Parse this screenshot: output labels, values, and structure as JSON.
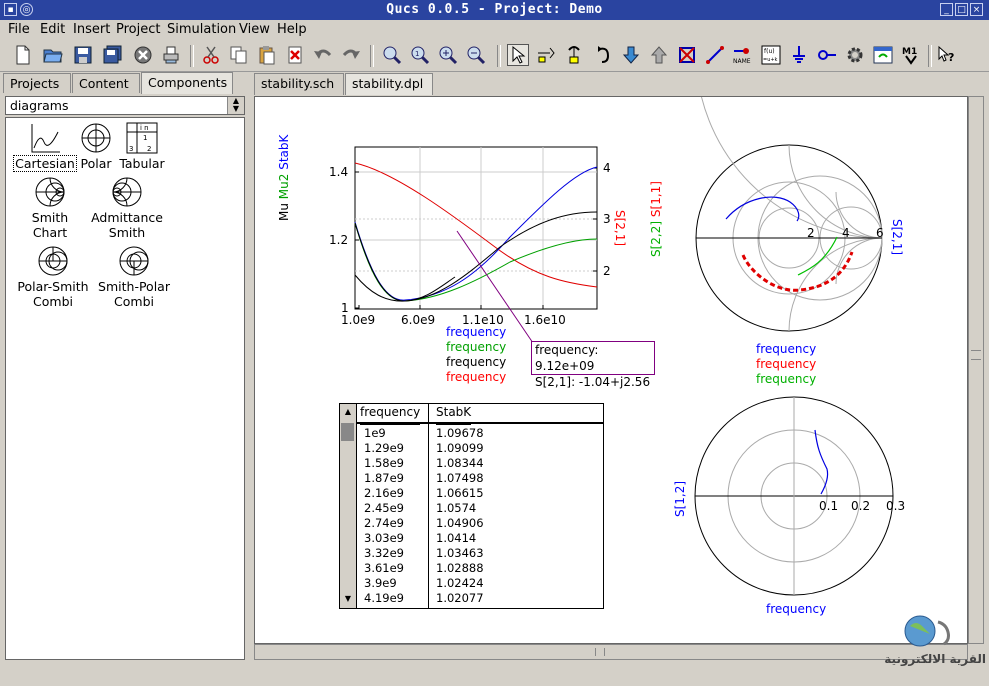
{
  "window": {
    "title": "Qucs 0.0.5 - Project: Demo"
  },
  "menubar": [
    "File",
    "Edit",
    "Insert",
    "Project",
    "Simulation",
    "View",
    "Help"
  ],
  "left_tabs": [
    "Projects",
    "Content",
    "Components"
  ],
  "combo": {
    "selected": "diagrams"
  },
  "components": [
    {
      "label": "Cartesian",
      "icon": "cartesian-icon"
    },
    {
      "label": "Polar",
      "icon": "polar-icon"
    },
    {
      "label": "Tabular",
      "icon": "tabular-icon"
    },
    {
      "label": "Smith Chart",
      "icon": "smith-chart-icon"
    },
    {
      "label": "Admittance Smith",
      "icon": "admittance-smith-icon"
    },
    {
      "label": "Polar-Smith Combi",
      "icon": "polar-smith-icon"
    },
    {
      "label": "Smith-Polar Combi",
      "icon": "smith-polar-icon"
    }
  ],
  "doc_tabs": [
    "stability.sch",
    "stability.dpl"
  ],
  "cartesian": {
    "ylabels_left": [
      {
        "text": "Mu",
        "color": "#000000"
      },
      {
        "text": "Mu2",
        "color": "#00a000"
      },
      {
        "text": "StabK",
        "color": "#0000ff"
      }
    ],
    "ylabel_right": {
      "text": "S[2,1]",
      "color": "#ff0000"
    },
    "yticks_left": [
      "1.4",
      "1.2",
      "1"
    ],
    "yticks_right": [
      "4",
      "3",
      "2"
    ],
    "xticks": [
      "1.0e9",
      "6.0e9",
      "1.1e10",
      "1.6e10"
    ],
    "legend": [
      {
        "text": "frequency",
        "color": "#0000ff"
      },
      {
        "text": "frequency",
        "color": "#00a000"
      },
      {
        "text": "frequency",
        "color": "#000000"
      },
      {
        "text": "frequency",
        "color": "#ff0000"
      }
    ]
  },
  "marker": {
    "line1": "frequency: 9.12e+09",
    "line2": "S[2,1]: -1.04+j2.56"
  },
  "smith": {
    "labels_left": [
      {
        "text": "S[2,2]",
        "color": "#00b000"
      },
      {
        "text": "S[1,1]",
        "color": "#ff0000"
      }
    ],
    "label_right": {
      "text": "S[2,1]",
      "color": "#0000ff"
    },
    "ticks": [
      "2",
      "4",
      "6"
    ],
    "legend": [
      {
        "text": "frequency",
        "color": "#0000ff"
      },
      {
        "text": "frequency",
        "color": "#ff0000"
      },
      {
        "text": "frequency",
        "color": "#00b000"
      }
    ]
  },
  "polar": {
    "label_left": {
      "text": "S[1,2]",
      "color": "#0000ff"
    },
    "ticks": [
      "0.1",
      "0.2",
      "0.3"
    ],
    "legend": {
      "text": "frequency",
      "color": "#0000ff"
    }
  },
  "table": {
    "headers": [
      "frequency",
      "StabK"
    ],
    "rows": [
      [
        "1e9",
        "1.09678"
      ],
      [
        "1.29e9",
        "1.09099"
      ],
      [
        "1.58e9",
        "1.08344"
      ],
      [
        "1.87e9",
        "1.07498"
      ],
      [
        "2.16e9",
        "1.06615"
      ],
      [
        "2.45e9",
        "1.0574"
      ],
      [
        "2.74e9",
        "1.04906"
      ],
      [
        "3.03e9",
        "1.0414"
      ],
      [
        "3.32e9",
        "1.03463"
      ],
      [
        "3.61e9",
        "1.02888"
      ],
      [
        "3.9e9",
        "1.02424"
      ],
      [
        "4.19e9",
        "1.02077"
      ]
    ]
  },
  "watermark": {
    "text": "القرية الالكترونية"
  }
}
